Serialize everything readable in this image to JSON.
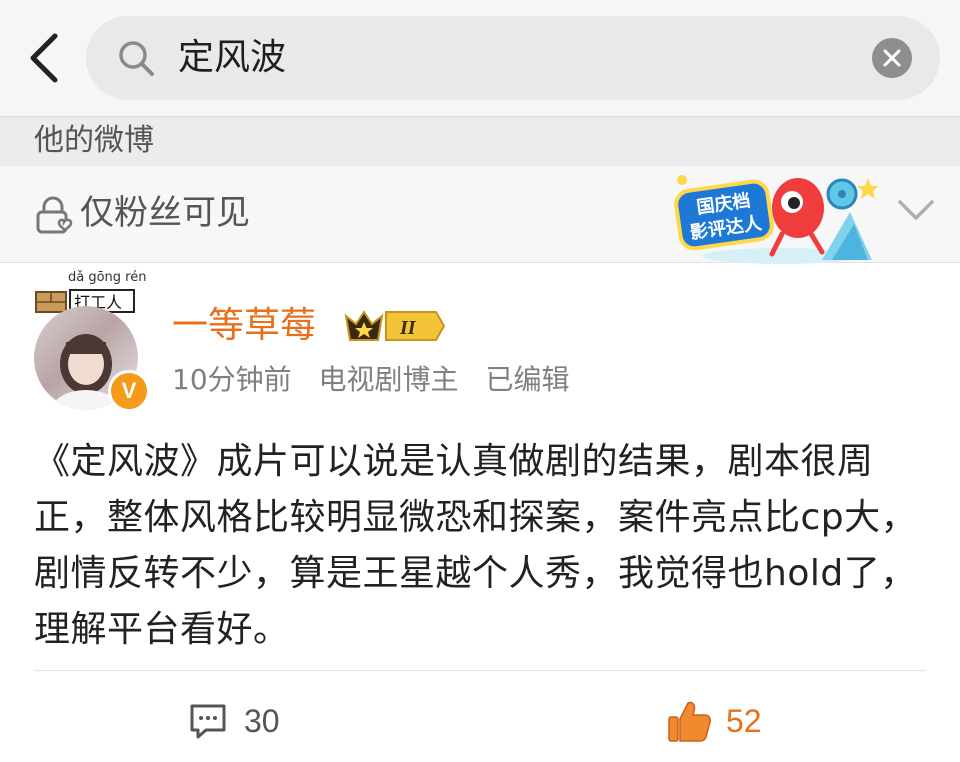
{
  "search": {
    "query": "定风波"
  },
  "section": {
    "label": "他的微博"
  },
  "visibility": {
    "label": "仅粉丝可见"
  },
  "badge": {
    "line1": "国庆档",
    "line2": "影评达人"
  },
  "user": {
    "name": "一等草莓",
    "level": "II",
    "avatar_tag_pinyin": "dǎ gōng rén",
    "avatar_tag_text": "打工人",
    "verify_mark": "V"
  },
  "meta": {
    "time": "10分钟前",
    "category": "电视剧博主",
    "edited": "已编辑"
  },
  "post": {
    "text": "《定风波》成片可以说是认真做剧的结果，剧本很周正，整体风格比较明显微恐和探案，案件亮点比cp大，剧情反转不少，算是王星越个人秀，我觉得也hold了，理解平台看好。"
  },
  "actions": {
    "comment_count": "30",
    "like_count": "52"
  },
  "colors": {
    "accent": "#e7701e",
    "verify": "#f59a1a"
  },
  "icons": [
    "back-arrow-icon",
    "search-icon",
    "clear-icon",
    "lock-icon",
    "chevron-down-icon",
    "comment-icon",
    "thumbs-up-icon",
    "level-crown-icon"
  ]
}
